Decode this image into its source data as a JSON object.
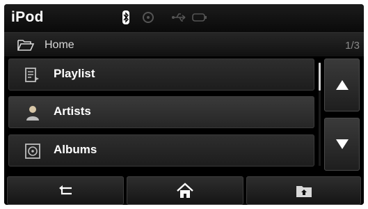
{
  "app": {
    "title": "iPod"
  },
  "status_icons": [
    "bluetooth-icon",
    "disc-icon",
    "usb-icon",
    "battery-icon"
  ],
  "path": {
    "folder_icon": "folder-open-icon",
    "label": "Home",
    "page_counter": "1/3"
  },
  "list": {
    "items": [
      {
        "label": "Playlist",
        "icon": "playlist-icon",
        "selected": false
      },
      {
        "label": "Artists",
        "icon": "artist-icon",
        "selected": true
      },
      {
        "label": "Albums",
        "icon": "album-icon",
        "selected": false
      }
    ]
  },
  "scroll": {
    "position": "top"
  },
  "nav": {
    "up_icon": "arrow-up-icon",
    "down_icon": "arrow-down-icon"
  },
  "bottom_bar": {
    "buttons": [
      "back-icon",
      "home-icon",
      "folder-up-icon"
    ]
  },
  "colors": {
    "background": "#000000",
    "text": "#ffffff",
    "path_text": "#d9d9d9",
    "counter_text": "#8a8a8a"
  }
}
